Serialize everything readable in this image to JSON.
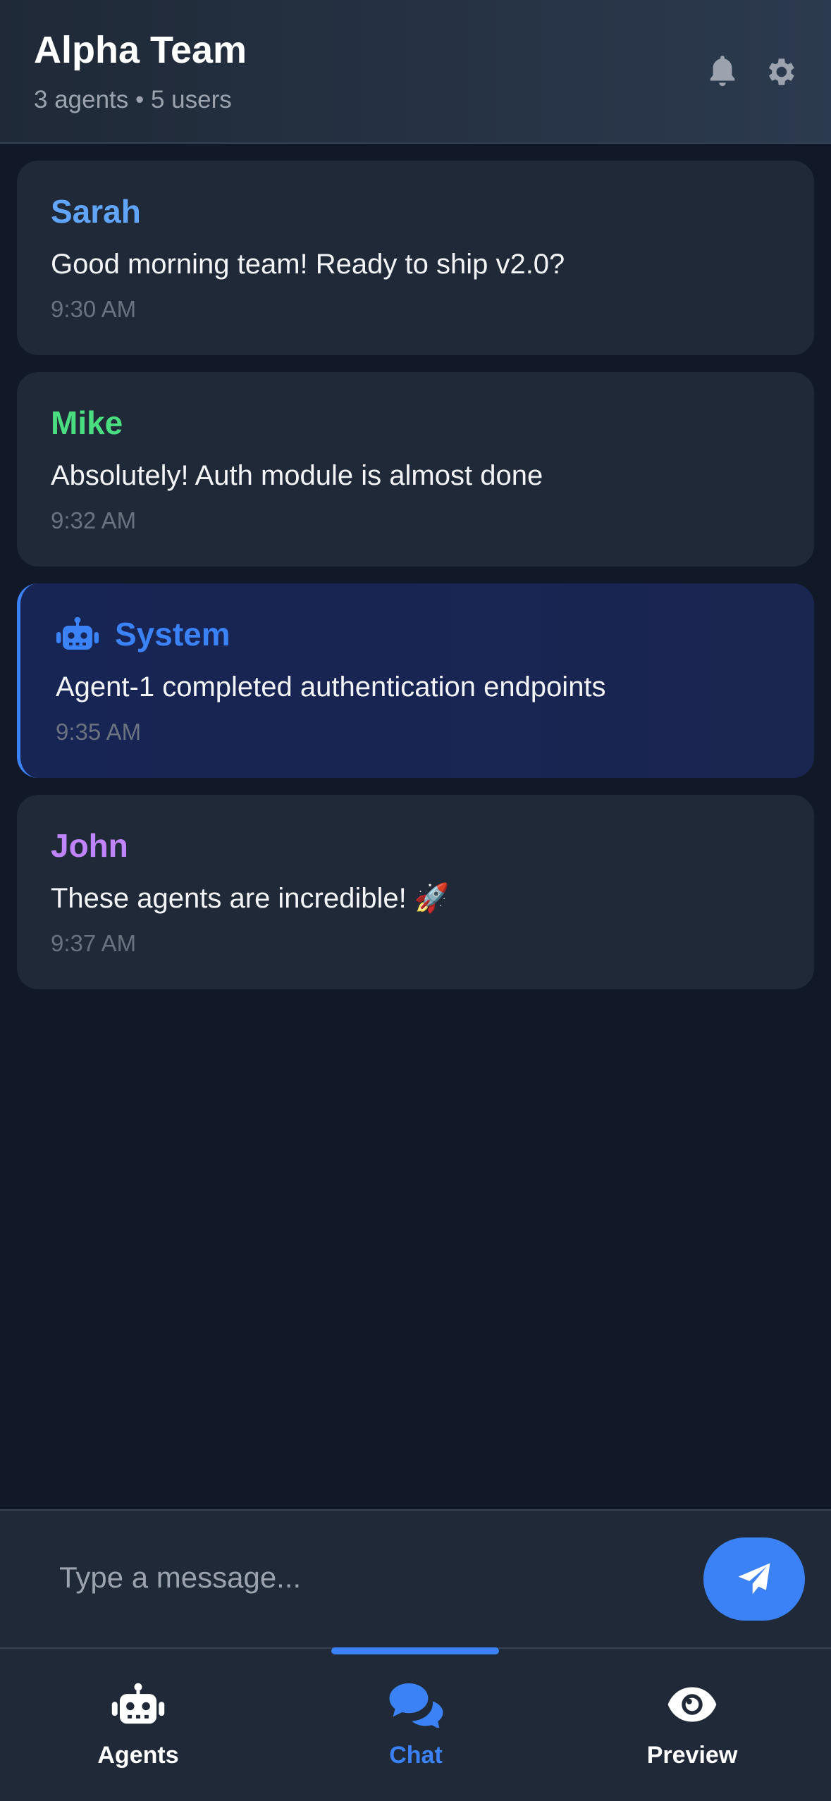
{
  "header": {
    "title": "Alpha Team",
    "subtitle": "3 agents • 5 users",
    "icons": [
      "bell-icon",
      "gear-icon"
    ]
  },
  "messages": [
    {
      "sender": "Sarah",
      "sender_color": "#60a5fa",
      "text": "Good morning team! Ready to ship v2.0?",
      "time": "9:30 AM",
      "type": "user"
    },
    {
      "sender": "Mike",
      "sender_color": "#4ade80",
      "text": "Absolutely! Auth module is almost done",
      "time": "9:32 AM",
      "type": "user"
    },
    {
      "sender": "System",
      "sender_color": "#3b82f6",
      "text": "Agent-1 completed authentication endpoints",
      "time": "9:35 AM",
      "type": "system",
      "icon": "robot-icon"
    },
    {
      "sender": "John",
      "sender_color": "#c084fc",
      "text": "These agents are incredible!",
      "emoji": "🚀",
      "time": "9:37 AM",
      "type": "user"
    }
  ],
  "composer": {
    "placeholder": "Type a message...",
    "value": "",
    "send_icon": "paper-plane-icon"
  },
  "nav": {
    "items": [
      {
        "label": "Agents",
        "icon": "robot-icon",
        "active": false
      },
      {
        "label": "Chat",
        "icon": "chat-bubbles-icon",
        "active": true
      },
      {
        "label": "Preview",
        "icon": "eye-icon",
        "active": false
      }
    ]
  },
  "colors": {
    "background": "#111827",
    "card": "#1f2937",
    "system_card": "#172554",
    "accent": "#3b82f6",
    "muted_text": "#9ca3af",
    "timestamp": "#6b7280"
  }
}
